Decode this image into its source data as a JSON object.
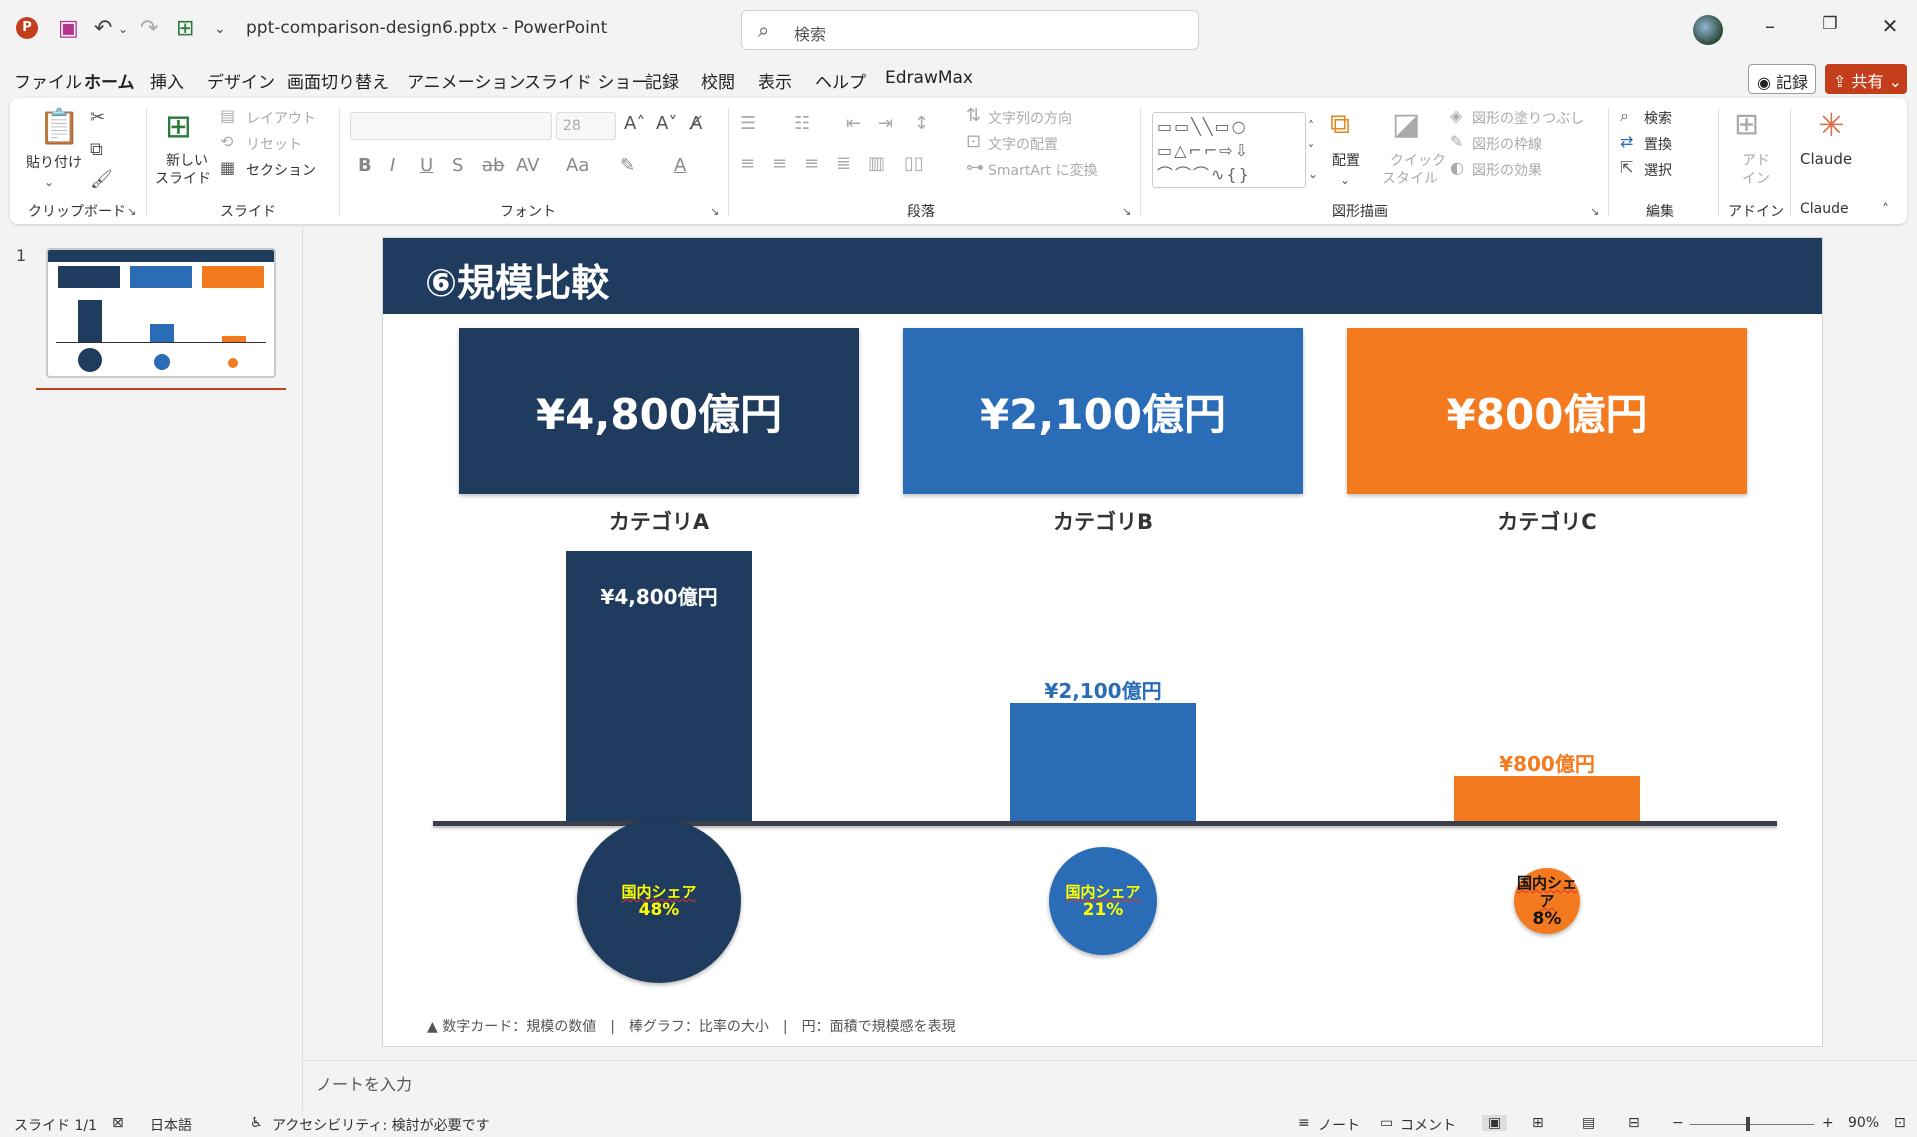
{
  "app": {
    "file_title": "ppt-comparison-design6.pptx  -  PowerPoint",
    "search_placeholder": "検索"
  },
  "menu": {
    "items": [
      "ファイル",
      "ホーム",
      "挿入",
      "デザイン",
      "画面切り替え",
      "アニメーション",
      "スライド ショー",
      "記録",
      "校閲",
      "表示",
      "ヘルプ",
      "EdrawMax"
    ],
    "active": "ホーム",
    "record_label": "記録",
    "share_label": "共有"
  },
  "ribbon": {
    "clipboard": {
      "paste": "貼り付け",
      "group": "クリップボード"
    },
    "slides": {
      "new_slide_1": "新しい",
      "new_slide_2": "スライド",
      "layout": "レイアウト",
      "reset": "リセット",
      "section": "セクション",
      "group": "スライド"
    },
    "font": {
      "font_size": "28",
      "group": "フォント"
    },
    "paragraph": {
      "text_direction": "文字列の方向",
      "align_text": "文字の配置",
      "smartart": "SmartArt に変換",
      "group": "段落"
    },
    "drawing": {
      "arrange": "配置",
      "quick_styles_1": "クイック",
      "quick_styles_2": "スタイル",
      "fill": "図形の塗りつぶし",
      "outline": "図形の枠線",
      "effects": "図形の効果",
      "group": "図形描画"
    },
    "editing": {
      "find": "検索",
      "replace": "置換",
      "select": "選択",
      "group": "編集"
    },
    "addins": {
      "addin_1": "アド",
      "addin_2": "イン",
      "group": "アドイン"
    },
    "claude": {
      "label": "Claude",
      "group": "Claude"
    }
  },
  "slide_panel": {
    "slide_number": "1"
  },
  "slide": {
    "title": "⑥規模比較",
    "categories": [
      {
        "name": "カテゴリA",
        "value_label": "¥4,800億円",
        "value": 4800,
        "share_label": "国内シェア",
        "share": "48%",
        "color": "#1f3b5e"
      },
      {
        "name": "カテゴリB",
        "value_label": "¥2,100億円",
        "value": 2100,
        "share_label": "国内シェア",
        "share": "21%",
        "color": "#2a6cb6"
      },
      {
        "name": "カテゴリC",
        "value_label": "¥800億円",
        "value": 800,
        "share_label": "国内シェア",
        "share": "8%",
        "color": "#f47a1f"
      }
    ],
    "legend": "▲ 数字カード：規模の数値　|　棒グラフ：比率の大小　|　円：面積で規模感を表現"
  },
  "chart_data": {
    "type": "bar",
    "categories": [
      "カテゴリA",
      "カテゴリB",
      "カテゴリC"
    ],
    "values": [
      4800,
      2100,
      800
    ],
    "data_labels": [
      "¥4,800億円",
      "¥2,100億円",
      "¥800億円"
    ],
    "shares": [
      48,
      21,
      8
    ],
    "title": "⑥規模比較"
  },
  "notes": {
    "placeholder": "ノートを入力"
  },
  "status": {
    "slide": "スライド 1/1",
    "language": "日本語",
    "accessibility": "アクセシビリティ: 検討が必要です",
    "notes": "ノート",
    "comments": "コメント",
    "zoom": "90%"
  },
  "colors": {
    "accent": "#c43e1c",
    "header": "#1f3b5e",
    "highlight_text": "#ffff00"
  }
}
